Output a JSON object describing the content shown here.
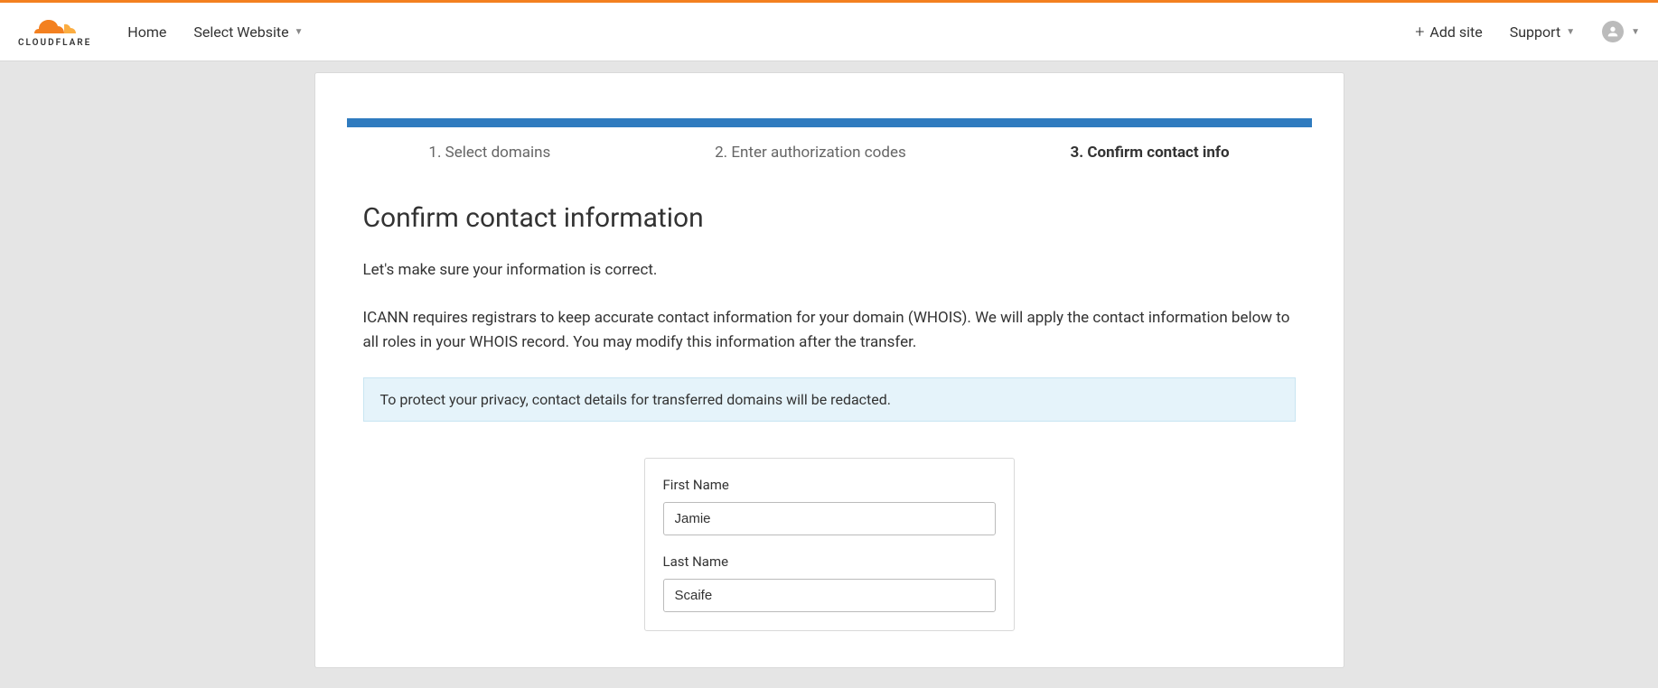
{
  "brand": {
    "name": "CLOUDFLARE"
  },
  "nav": {
    "home": "Home",
    "select_website": "Select Website",
    "add_site": "Add site",
    "support": "Support"
  },
  "steps": {
    "step1": "1. Select domains",
    "step2": "2. Enter authorization codes",
    "step3": "3. Confirm contact info"
  },
  "page": {
    "title": "Confirm contact information",
    "subtitle": "Let's make sure your information is correct.",
    "description": "ICANN requires registrars to keep accurate contact information for your domain (WHOIS). We will apply the contact information below to all roles in your WHOIS record. You may modify this information after the transfer.",
    "info_banner": "To protect your privacy, contact details for transferred domains will be redacted."
  },
  "form": {
    "first_name": {
      "label": "First Name",
      "value": "Jamie"
    },
    "last_name": {
      "label": "Last Name",
      "value": "Scaife"
    }
  }
}
